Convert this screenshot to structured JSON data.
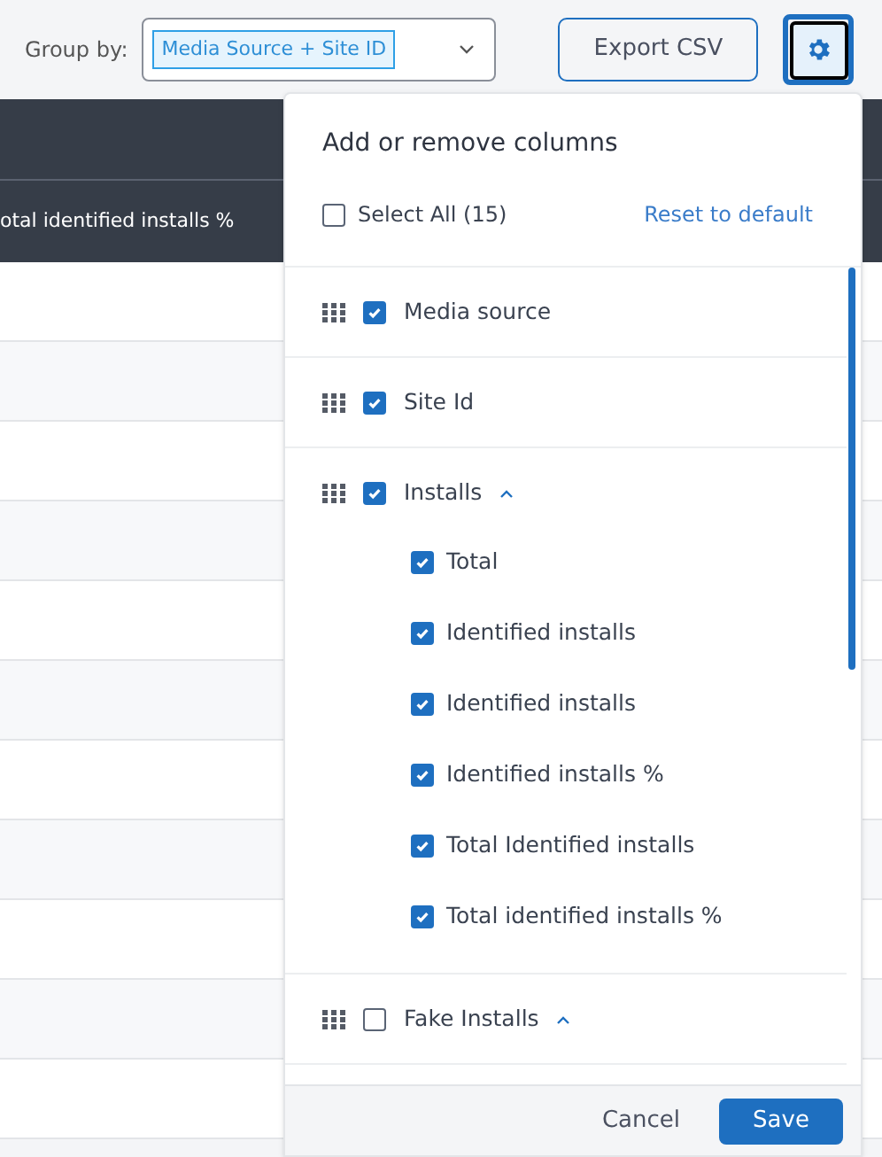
{
  "toolbar": {
    "group_by_label": "Group by:",
    "group_by_value": "Media Source + Site ID",
    "export_button": "Export CSV"
  },
  "table": {
    "header_cell": "otal identified installs %"
  },
  "columns_panel": {
    "title": "Add or remove columns",
    "select_all": {
      "label": "Select All (15)",
      "checked": false
    },
    "reset_link": "Reset to default",
    "items": [
      {
        "label": "Media source",
        "checked": true
      },
      {
        "label": "Site Id",
        "checked": true
      },
      {
        "label": "Installs",
        "checked": true,
        "expanded": true,
        "children": [
          {
            "label": "Total",
            "checked": true
          },
          {
            "label": "Identified installs",
            "checked": true
          },
          {
            "label": "Identified installs",
            "checked": true
          },
          {
            "label": "Identified installs %",
            "checked": true
          },
          {
            "label": "Total Identified installs",
            "checked": true
          },
          {
            "label": "Total identified installs %",
            "checked": true
          }
        ]
      },
      {
        "label": "Fake Installs",
        "checked": false,
        "expanded": true
      }
    ],
    "cancel_button": "Cancel",
    "save_button": "Save"
  }
}
